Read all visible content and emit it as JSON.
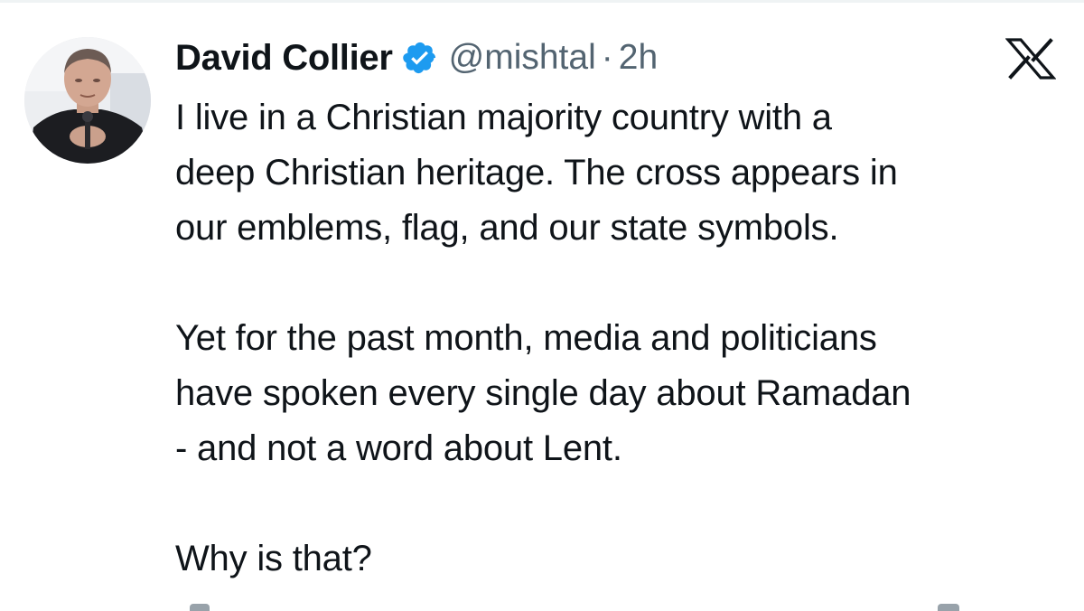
{
  "author": {
    "display_name": "David Collier",
    "handle": "@mishtal",
    "separator": "·",
    "timestamp": "2h",
    "verified": true,
    "avatar_icon": "person-photo"
  },
  "tweet": {
    "paragraph1_lines": [
      "I live in a Christian majority country with a",
      "deep Christian heritage. The cross appears in",
      "our emblems, flag, and our state symbols."
    ],
    "paragraph2_lines": [
      "Yet for the past month, media and politicians",
      "have spoken every single day about Ramadan",
      "- and not a word about Lent."
    ],
    "paragraph3_lines": [
      "Why is that?"
    ]
  },
  "icons": {
    "verified": "verified-badge-icon",
    "platform": "x-logo-icon"
  },
  "colors": {
    "verified_blue": "#1d9bf0",
    "text": "#0f1419",
    "secondary": "#536471"
  }
}
